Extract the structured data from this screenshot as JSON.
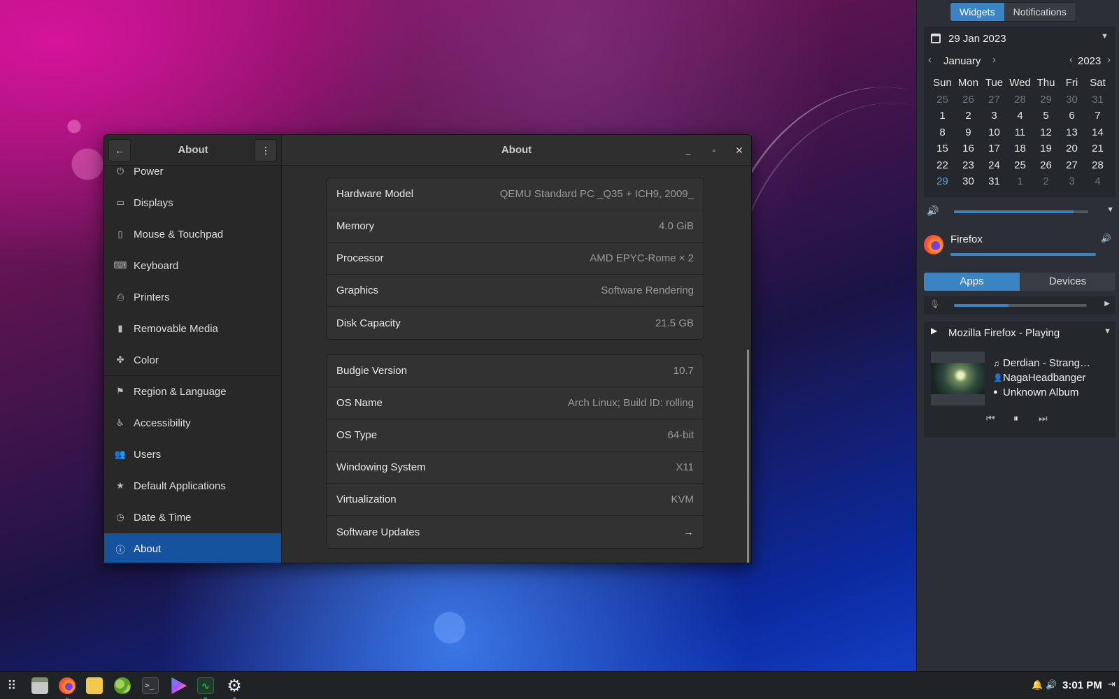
{
  "settings_window": {
    "sidebar_title": "About",
    "main_title": "About",
    "sidebar_items": [
      {
        "label": "Power",
        "icon": "power-icon",
        "glyph": "⏻"
      },
      {
        "label": "Displays",
        "icon": "display-icon",
        "glyph": "▭"
      },
      {
        "label": "Mouse & Touchpad",
        "icon": "mouse-icon",
        "glyph": "▯"
      },
      {
        "label": "Keyboard",
        "icon": "keyboard-icon",
        "glyph": "⌨"
      },
      {
        "label": "Printers",
        "icon": "printer-icon",
        "glyph": "⎙"
      },
      {
        "label": "Removable Media",
        "icon": "usb-icon",
        "glyph": "▮"
      },
      {
        "label": "Color",
        "icon": "color-icon",
        "glyph": "✤"
      },
      {
        "label": "Region & Language",
        "icon": "flag-icon",
        "glyph": "⚑"
      },
      {
        "label": "Accessibility",
        "icon": "accessibility-icon",
        "glyph": "♿"
      },
      {
        "label": "Users",
        "icon": "users-icon",
        "glyph": "👥"
      },
      {
        "label": "Default Applications",
        "icon": "star-icon",
        "glyph": "★"
      },
      {
        "label": "Date & Time",
        "icon": "clock-icon",
        "glyph": "◷"
      },
      {
        "label": "About",
        "icon": "info-icon",
        "glyph": "ⓘ"
      }
    ],
    "hardware_rows": [
      {
        "label": "Hardware Model",
        "value": "QEMU Standard PC _Q35 + ICH9, 2009_"
      },
      {
        "label": "Memory",
        "value": "4.0 GiB"
      },
      {
        "label": "Processor",
        "value": "AMD EPYC-Rome × 2"
      },
      {
        "label": "Graphics",
        "value": "Software Rendering"
      },
      {
        "label": "Disk Capacity",
        "value": "21.5 GB"
      }
    ],
    "software_rows": [
      {
        "label": "Budgie Version",
        "value": "10.7"
      },
      {
        "label": "OS Name",
        "value": "Arch Linux; Build ID: rolling"
      },
      {
        "label": "OS Type",
        "value": "64-bit"
      },
      {
        "label": "Windowing System",
        "value": "X11"
      },
      {
        "label": "Virtualization",
        "value": "KVM"
      },
      {
        "label": "Software Updates",
        "value": "→"
      }
    ]
  },
  "raven": {
    "tabs": [
      "Widgets",
      "Notifications"
    ],
    "date_header": "29 Jan 2023",
    "month": "January",
    "year": "2023",
    "weekdays": [
      "Sun",
      "Mon",
      "Tue",
      "Wed",
      "Thu",
      "Fri",
      "Sat"
    ],
    "days": [
      [
        "25",
        "26",
        "27",
        "28",
        "29",
        "30",
        "31"
      ],
      [
        "1",
        "2",
        "3",
        "4",
        "5",
        "6",
        "7"
      ],
      [
        "8",
        "9",
        "10",
        "11",
        "12",
        "13",
        "14"
      ],
      [
        "15",
        "16",
        "17",
        "18",
        "19",
        "20",
        "21"
      ],
      [
        "22",
        "23",
        "24",
        "25",
        "26",
        "27",
        "28"
      ],
      [
        "29",
        "30",
        "31",
        "1",
        "2",
        "3",
        "4"
      ]
    ],
    "volume_level": 0.89,
    "app_name": "Firefox",
    "app_volume_level": 1.0,
    "sound_tabs": [
      "Apps",
      "Devices"
    ],
    "mic_level": 0.41,
    "player_title": "Mozilla Firefox - Playing",
    "track": "Derdian - Strang…",
    "artist": "NagaHeadbanger",
    "album": "Unknown Album"
  },
  "taskbar": {
    "clock": "3:01 PM",
    "apps": [
      "app-grid-icon",
      "files-icon",
      "firefox-icon",
      "mail-icon",
      "hexchat-icon",
      "terminal-icon",
      "player-icon",
      "system-monitor-icon",
      "settings-icon"
    ]
  },
  "colors": {
    "accent": "#3b84c4",
    "selection": "#15539e"
  }
}
